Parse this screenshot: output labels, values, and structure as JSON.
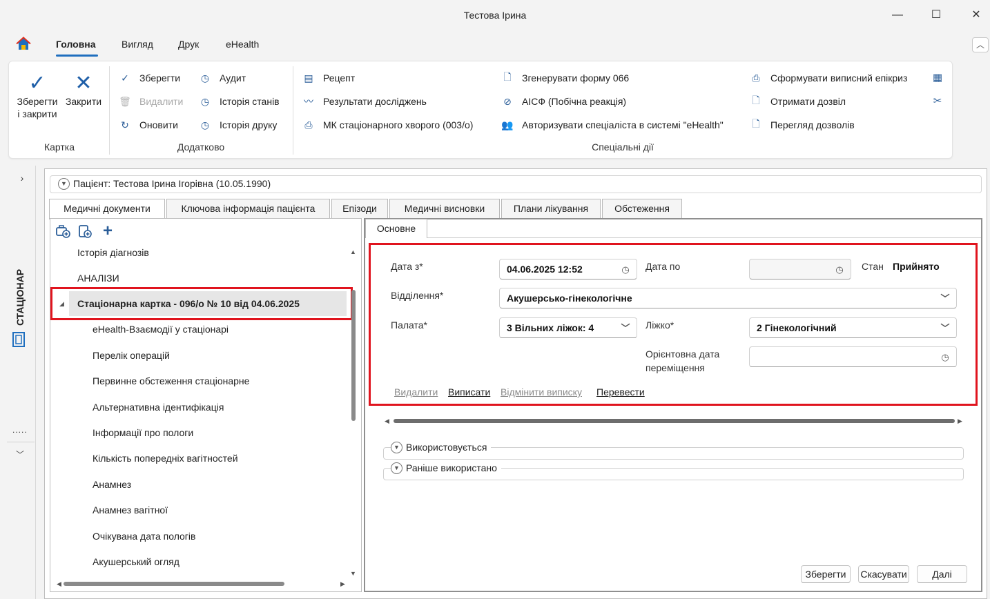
{
  "window": {
    "title": "Тестова Ірина",
    "minimize": "—",
    "maximize": "☐",
    "close": "✕"
  },
  "menu": {
    "home_icon": "home-icon",
    "tabs": [
      "Головна",
      "Вигляд",
      "Друк",
      "eHealth"
    ],
    "active": "Головна"
  },
  "ribbon": {
    "karta": {
      "label": "Картка",
      "save_close": {
        "line1": "Зберегти",
        "line2": "і закрити",
        "icon": "check-icon"
      },
      "close": {
        "label": "Закрити",
        "icon": "close-x-icon"
      }
    },
    "dodatkovo": {
      "label": "Додатково",
      "save": "Зберегти",
      "delete": "Видалити",
      "refresh": "Оновити",
      "audit": "Аудит",
      "state_history": "Історія станів",
      "print_history": "Історія друку"
    },
    "special": {
      "label": "Спеціальні дії",
      "recipe": "Рецепт",
      "research_results": "Результати досліджень",
      "mk_form": "МК стаціонарного хворого (003/о)",
      "generate_066": "Згенерувати форму 066",
      "aisf": "АІСФ (Побічна реакція)",
      "authorize": "Авторизувати спеціаліста в системі \"eHealth\"",
      "epicrisis": "Сформувати виписний епікриз",
      "get_permission": "Отримати дозвіл",
      "view_permissions": "Перегляд дозволів"
    }
  },
  "sidebar": {
    "vertical_label": "СТАЦІОНАР",
    "dots": "....."
  },
  "patient": {
    "label": "Пацієнт: Тестова Ірина Ігорівна (10.05.1990)"
  },
  "doc_tabs": [
    "Медичні документи",
    "Ключова інформація пацієнта",
    "Епізоди",
    "Медичні висновки",
    "Плани лікування",
    "Обстеження"
  ],
  "tree": {
    "items_top": [
      "Історія діагнозів",
      "АНАЛІЗИ"
    ],
    "selected": "Стаціонарна картка - 096/о № 10 від 04.06.2025",
    "children": [
      "eHealth-Взаємодії у стаціонарі",
      "Перелік операцій",
      "Первинне обстеження стаціонарне",
      "Альтернативна ідентифікація",
      "Інформації про пологи",
      "Кількість попередніх вагітностей",
      "Анамнез",
      "Анамнез вагітної",
      "Очікувана дата пологів",
      "Акушерський огляд"
    ]
  },
  "form": {
    "tab": "Основне",
    "date_from_label": "Дата з*",
    "date_from_value": "04.06.2025 12:52",
    "date_to_label": "Дата по",
    "date_to_value": "",
    "state_label": "Стан",
    "state_value": "Прийнято",
    "department_label": "Відділення*",
    "department_value": "Акушерсько-гінекологічне",
    "ward_label": "Палата*",
    "ward_value": "3 Вільних ліжок: 4",
    "bed_label": "Ліжко*",
    "bed_value": "2 Гінекологічний",
    "move_date_label_1": "Орієнтовна дата",
    "move_date_label_2": "переміщення",
    "move_date_value": "",
    "actions": {
      "delete": "Видалити",
      "discharge": "Виписати",
      "cancel_discharge": "Відмінити виписку",
      "transfer": "Перевести"
    }
  },
  "sections": {
    "in_use": "Використовується",
    "used_before": "Раніше використано"
  },
  "buttons": {
    "save": "Зберегти",
    "cancel": "Скасувати",
    "next": "Далі"
  },
  "colors": {
    "accent": "#1f6fbf",
    "highlight_border": "#e0141e",
    "icon_blue": "#2a5d98"
  }
}
